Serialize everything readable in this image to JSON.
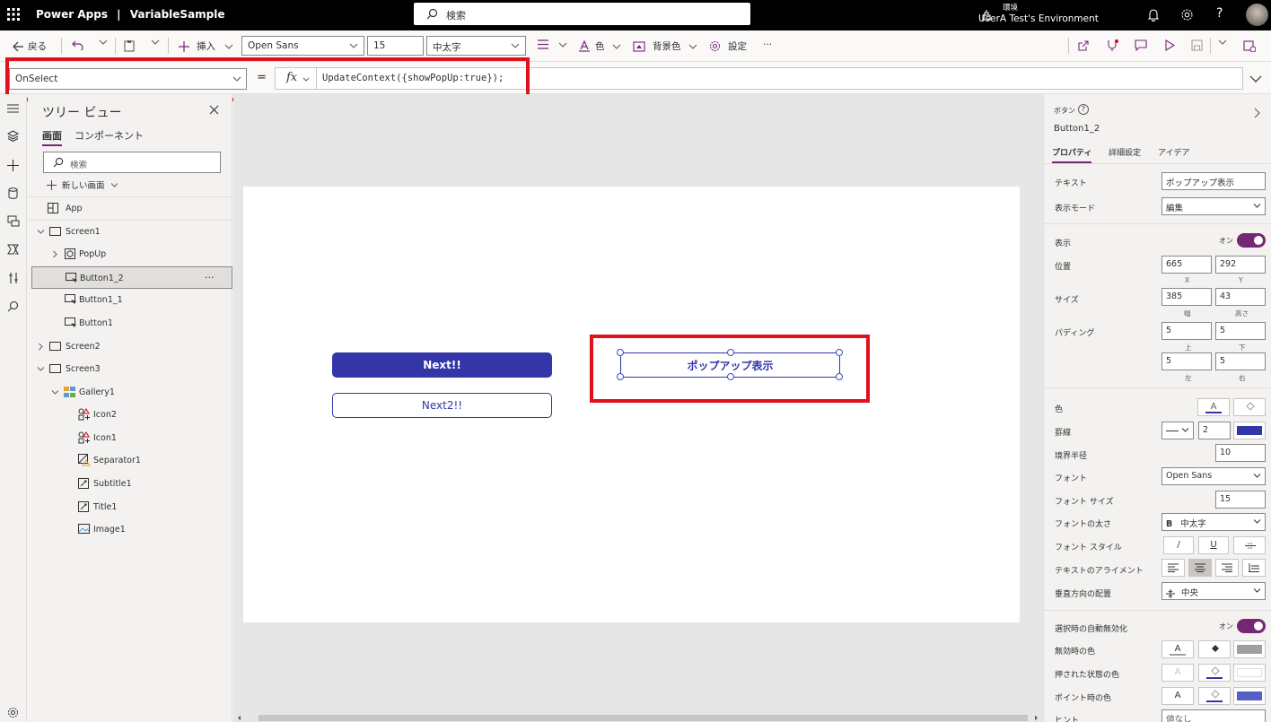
{
  "topbar": {
    "app_name": "Power Apps",
    "separator": "|",
    "file_name": "VariableSample",
    "search_placeholder": "検索",
    "env_label": "環境",
    "env_name": "UserA Test's Environment"
  },
  "cmdbar": {
    "back": "戻る",
    "insert": "挿入",
    "font": "Open Sans",
    "font_size": "15",
    "font_weight": "中太字",
    "color": "色",
    "background": "背景色",
    "settings": "設定",
    "more": "···"
  },
  "formula": {
    "property": "OnSelect",
    "equals": "=",
    "fx": "fx",
    "text": "UpdateContext({showPopUp:true});"
  },
  "tree": {
    "title": "ツリー ビュー",
    "tab_screens": "画面",
    "tab_components": "コンポーネント",
    "search_placeholder": "検索",
    "new_screen": "新しい画面",
    "items": [
      {
        "label": "App"
      },
      {
        "label": "Screen1"
      },
      {
        "label": "PopUp"
      },
      {
        "label": "Button1_2"
      },
      {
        "label": "Button1_1"
      },
      {
        "label": "Button1"
      },
      {
        "label": "Screen2"
      },
      {
        "label": "Screen3"
      },
      {
        "label": "Gallery1"
      },
      {
        "label": "Icon2"
      },
      {
        "label": "Icon1"
      },
      {
        "label": "Separator1"
      },
      {
        "label": "Subtitle1"
      },
      {
        "label": "Title1"
      },
      {
        "label": "Image1"
      }
    ],
    "more": "···"
  },
  "canvas": {
    "btn_next": "Next!!",
    "btn_next2": "Next2!!",
    "btn_popup": "ポップアップ表示"
  },
  "props": {
    "type": "ボタン",
    "name": "Button1_2",
    "tabs": [
      "プロパティ",
      "詳細設定",
      "アイデア"
    ],
    "text_label": "テキスト",
    "text_value": "ポップアップ表示",
    "display_mode_label": "表示モード",
    "display_mode_value": "編集",
    "visible_label": "表示",
    "on": "オン",
    "position_label": "位置",
    "x": "665",
    "y": "292",
    "x_lab": "X",
    "y_lab": "Y",
    "size_label": "サイズ",
    "width": "385",
    "height": "43",
    "width_lab": "幅",
    "height_lab": "高さ",
    "padding_label": "パディング",
    "pad_top": "5",
    "pad_bottom": "5",
    "pad_left": "5",
    "pad_right": "5",
    "top_lab": "上",
    "bottom_lab": "下",
    "left_lab": "左",
    "right_lab": "右",
    "color_label": "色",
    "border_label": "罫線",
    "border_width": "2",
    "radius_label": "境界半径",
    "radius": "10",
    "font_label": "フォント",
    "font_value": "Open Sans",
    "font_size_label": "フォント サイズ",
    "font_size_value": "15",
    "font_weight_label": "フォントの太さ",
    "font_weight_value": "中太字",
    "font_style_label": "フォント スタイル",
    "align_label": "テキストのアライメント",
    "valign_label": "垂直方向の配置",
    "valign_value": "中央",
    "auto_disable_label": "選択時の自動無効化",
    "disabled_color_label": "無効時の色",
    "pressed_color_label": "押された状態の色",
    "hover_color_label": "ポイント時の色",
    "tooltip_label": "ヒント",
    "tooltip_value": "値なし",
    "glyph_a": "A",
    "bold_glyph": "B",
    "italic_glyph": "/",
    "underline_glyph": "U"
  },
  "colors": {
    "accent": "#3236a8",
    "toggle": "#742774",
    "red_highlight": "#e0111d"
  }
}
